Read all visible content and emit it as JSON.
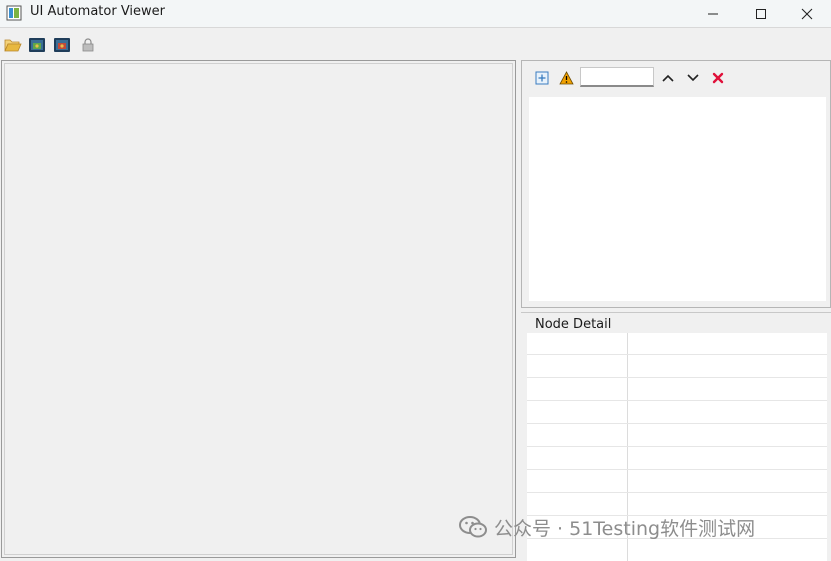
{
  "window": {
    "title": "UI Automator Viewer",
    "controls": [
      "minimize-icon",
      "maximize-icon",
      "close-icon"
    ]
  },
  "toolbar": {
    "buttons": [
      {
        "name": "open-icon"
      },
      {
        "name": "device-screenshot-icon"
      },
      {
        "name": "device-screenshot-compressed-icon"
      },
      {
        "name": "save-icon"
      }
    ]
  },
  "hierarchy": {
    "buttons": [
      "expand-all-icon",
      "warning-icon",
      "previous-icon",
      "next-icon",
      "clear-icon"
    ],
    "search": {
      "value": "",
      "placeholder": ""
    }
  },
  "node_detail": {
    "label": "Node Detail",
    "rows": 9
  },
  "watermark": {
    "text": "公众号 · 51Testing软件测试网"
  },
  "colors": {
    "accent_clear": "#e0103a",
    "warning": "#f0a000",
    "folder": "#e8b840"
  }
}
